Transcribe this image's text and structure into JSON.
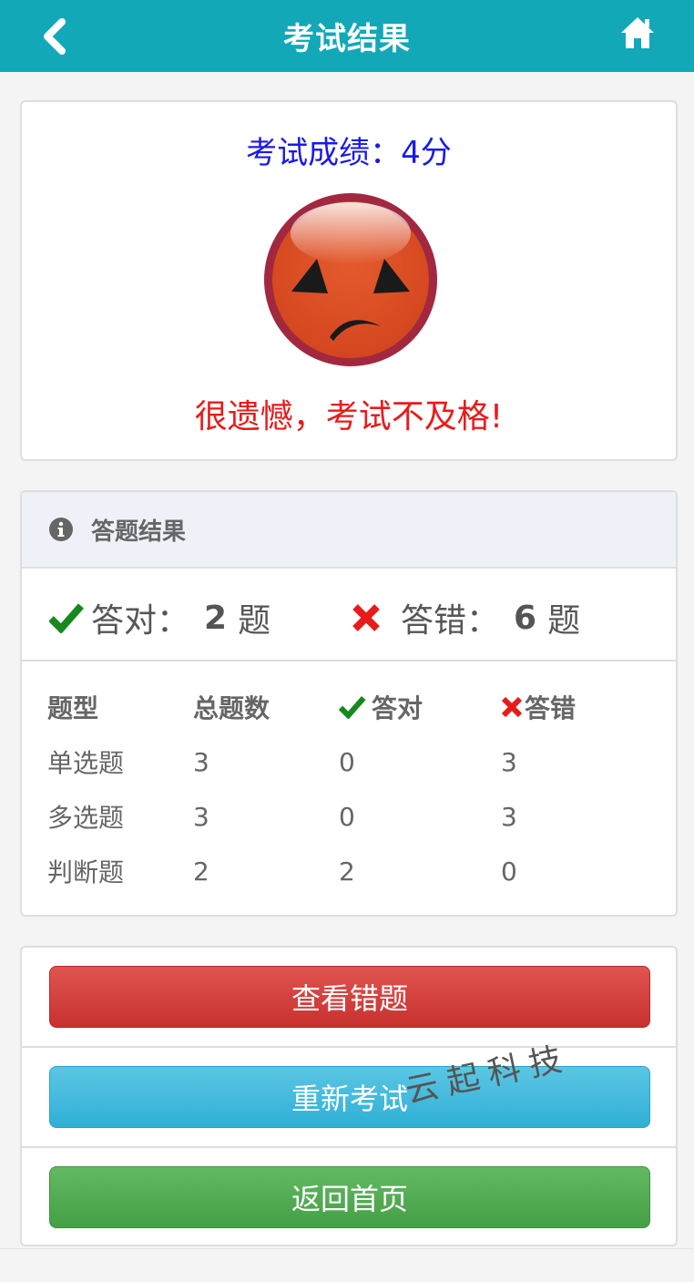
{
  "header": {
    "title": "考试结果",
    "back_icon": "chevron-left-icon",
    "home_icon": "home-icon",
    "color": "#13a8b8"
  },
  "score": {
    "text": "考试成绩：4分",
    "status_text": "很遗憾，考试不及格!",
    "face_icon": "sad-face-icon"
  },
  "result": {
    "heading": "答题结果",
    "correct_label": "答对：",
    "correct_count": "2",
    "wrong_label": "答错：",
    "wrong_count": "6",
    "unit": "题",
    "columns": [
      "题型",
      "总题数",
      "答对",
      "答错"
    ],
    "rows": [
      [
        "单选题",
        "3",
        "0",
        "3"
      ],
      [
        "多选题",
        "3",
        "0",
        "3"
      ],
      [
        "判断题",
        "2",
        "2",
        "0"
      ]
    ]
  },
  "actions": {
    "view_wrong": "查看错题",
    "retake": "重新考试",
    "home": "返回首页"
  },
  "watermark": "云起科技"
}
